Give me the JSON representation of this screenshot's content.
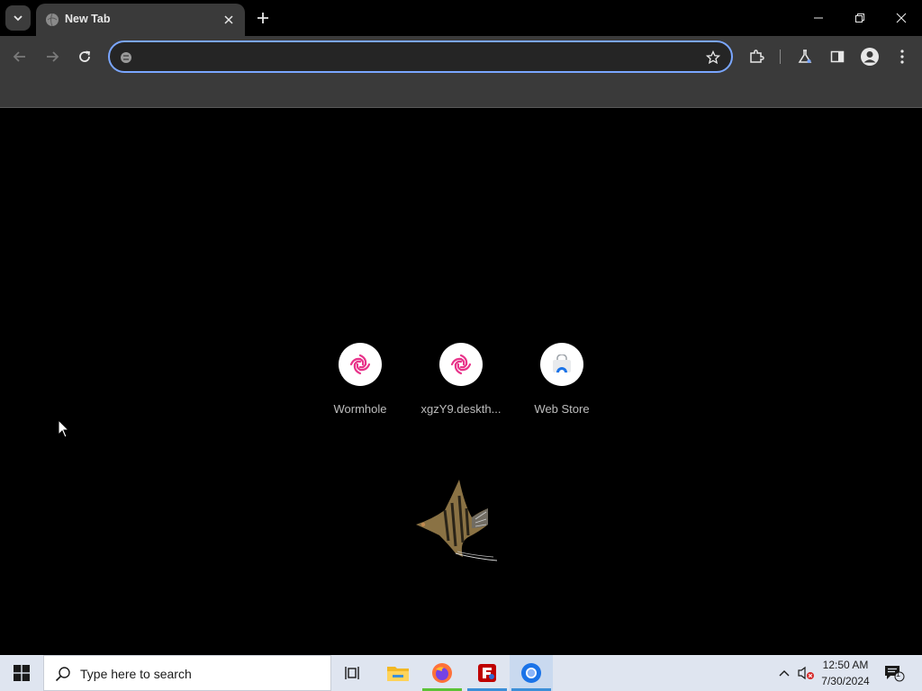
{
  "browser": {
    "tab": {
      "title": "New Tab"
    },
    "omnibox": {
      "value": "",
      "placeholder": ""
    }
  },
  "shortcuts": [
    {
      "label": "Wormhole",
      "icon": "wormhole-icon"
    },
    {
      "label": "xgzY9.deskth...",
      "icon": "wormhole-icon"
    },
    {
      "label": "Web Store",
      "icon": "web-store-icon"
    }
  ],
  "taskbar": {
    "search_placeholder": "Type here to search",
    "apps": [
      "task-view",
      "file-explorer",
      "firefox",
      "filezilla",
      "chrome"
    ],
    "clock": {
      "time": "12:50 AM",
      "date": "7/30/2024"
    },
    "notification_count": "1"
  },
  "colors": {
    "accent": "#7aa6ff",
    "toolbar_bg": "#3a3a3a",
    "page_bg": "#000000",
    "taskbar_bg": "#dfe5f0",
    "wormhole_pink": "#e8338a"
  }
}
